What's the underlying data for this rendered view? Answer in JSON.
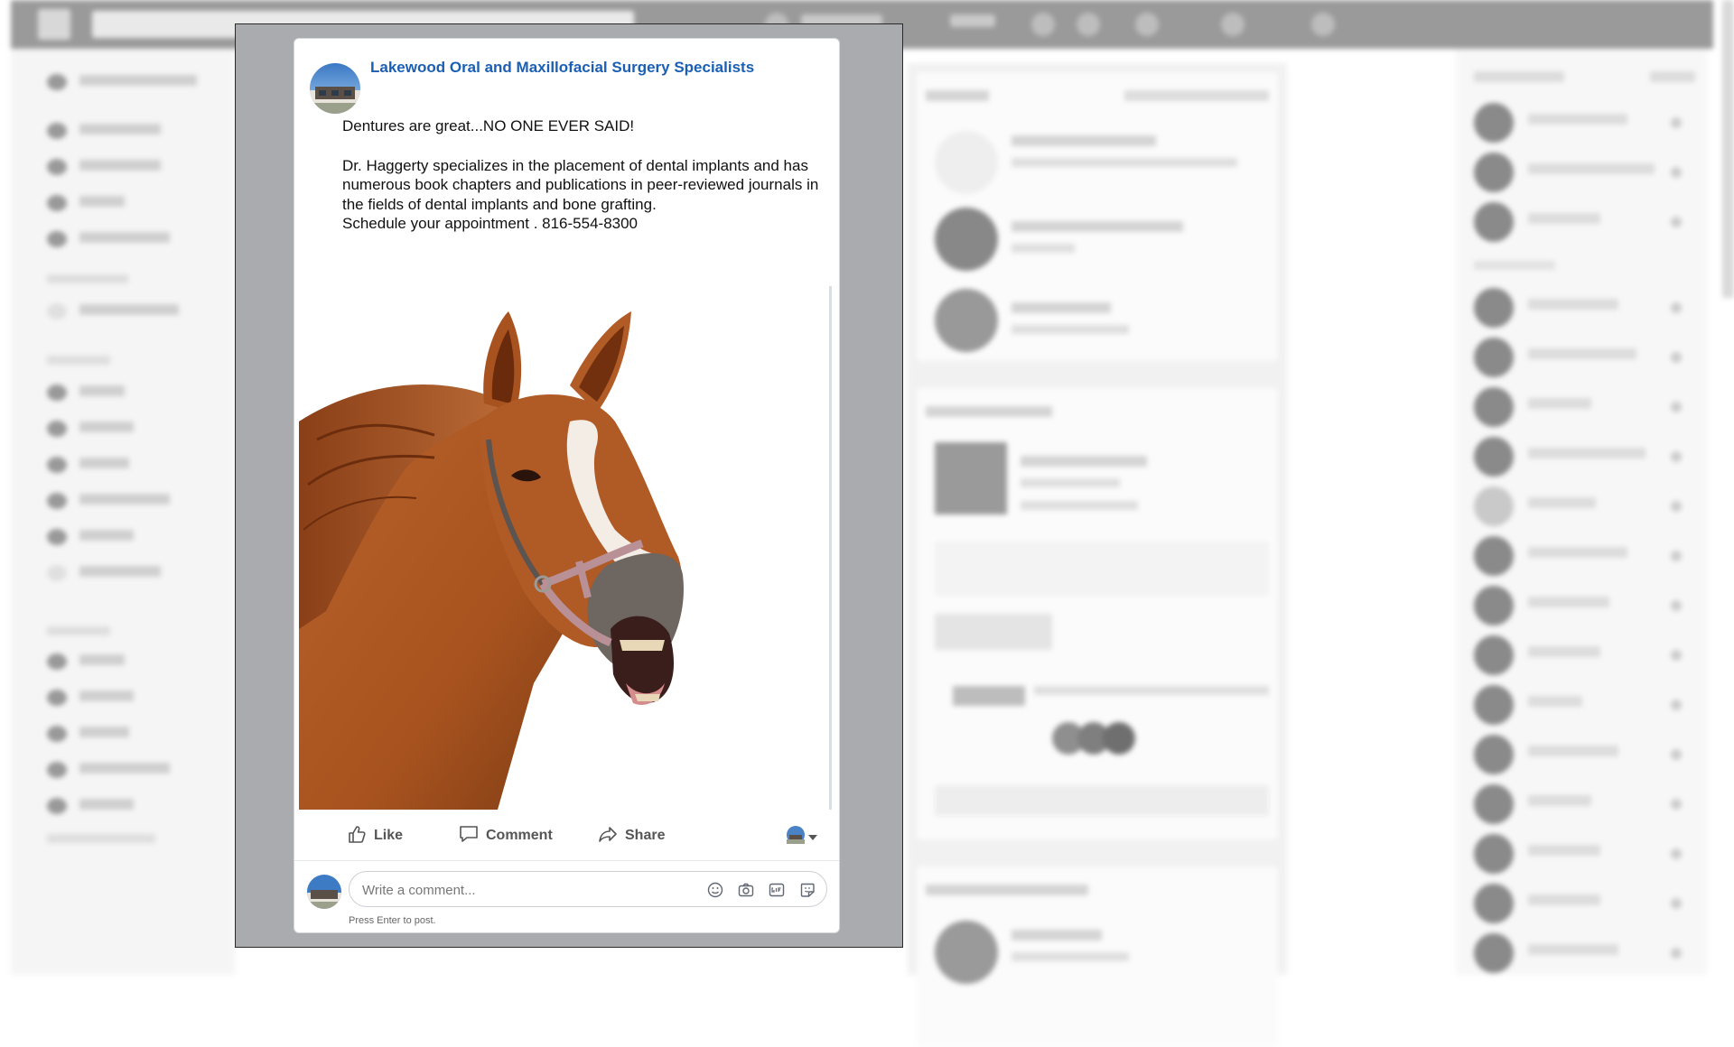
{
  "post": {
    "page_name": "Lakewood Oral and Maxillofacial Surgery Specialists",
    "text_line1": "Dentures are great...NO ONE EVER SAID!",
    "text_para": "Dr. Haggerty specializes in the placement of dental implants and has numerous book chapters and publications in peer-reviewed journals in the fields of dental implants and bone grafting.",
    "text_cta": "Schedule your appointment . 816-554-8300"
  },
  "actions": {
    "like": "Like",
    "comment": "Comment",
    "share": "Share"
  },
  "comment_box": {
    "placeholder": "Write a comment...",
    "hint": "Press Enter to post."
  },
  "icons": [
    "thumbs-up-icon",
    "comment-icon",
    "share-icon",
    "emoji-icon",
    "camera-icon",
    "gif-icon",
    "sticker-icon",
    "chevron-down-icon"
  ],
  "colors": {
    "page_name": "#1a5fb4",
    "overlay": "#a9abaf",
    "action_text": "#555555"
  }
}
